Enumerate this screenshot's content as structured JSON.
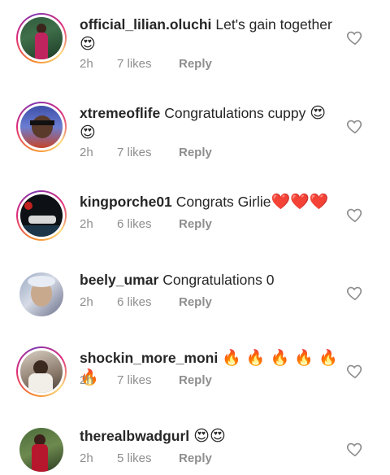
{
  "comments": [
    {
      "username": "official_lilian.oluchi",
      "text": "Let's gain together",
      "emoji": "😍",
      "time": "2h",
      "likes": "7 likes",
      "reply": "Reply"
    },
    {
      "username": "xtremeoflife",
      "text": "Congratulations cuppy",
      "emoji": "😍",
      "emoji2": "😍",
      "time": "2h",
      "likes": "7 likes",
      "reply": "Reply"
    },
    {
      "username": "kingporche01",
      "text": "Congrats Girlie",
      "emoji": "❤️❤️❤️",
      "time": "2h",
      "likes": "6 likes",
      "reply": "Reply"
    },
    {
      "username": "beely_umar",
      "text": "Congratulations 0",
      "time": "2h",
      "likes": "6 likes",
      "reply": "Reply"
    },
    {
      "username": "shockin_more_moni",
      "emoji": "🔥 🔥 🔥 🔥 🔥 🔥",
      "time": "2h",
      "likes": "7 likes",
      "reply": "Reply"
    },
    {
      "username": "therealbwadgurl",
      "emoji": "😍😍",
      "time": "2h",
      "likes": "5 likes",
      "reply": "Reply"
    }
  ],
  "icons": {
    "like": "heart-outline-icon"
  },
  "colors": {
    "username": "#262626",
    "meta": "#8e8e8e",
    "story_ring": "#dd2a7b"
  }
}
